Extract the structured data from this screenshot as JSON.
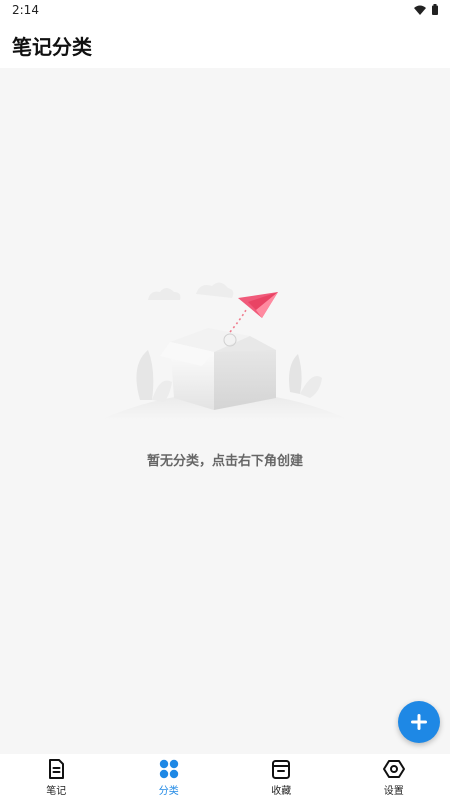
{
  "status_bar": {
    "time": "2:14",
    "icons": [
      "wifi-icon",
      "battery-icon"
    ]
  },
  "header": {
    "title": "笔记分类"
  },
  "empty_state": {
    "illustration": "empty-box-with-paper-plane",
    "message": "暂无分类，点击右下角创建"
  },
  "fab": {
    "icon": "plus-icon",
    "color": "#1e88e5"
  },
  "bottom_nav": {
    "active_index": 1,
    "active_color": "#1e88e5",
    "items": [
      {
        "label": "笔记",
        "icon": "note-icon"
      },
      {
        "label": "分类",
        "icon": "category-icon"
      },
      {
        "label": "收藏",
        "icon": "favorite-box-icon"
      },
      {
        "label": "设置",
        "icon": "settings-icon"
      }
    ]
  }
}
